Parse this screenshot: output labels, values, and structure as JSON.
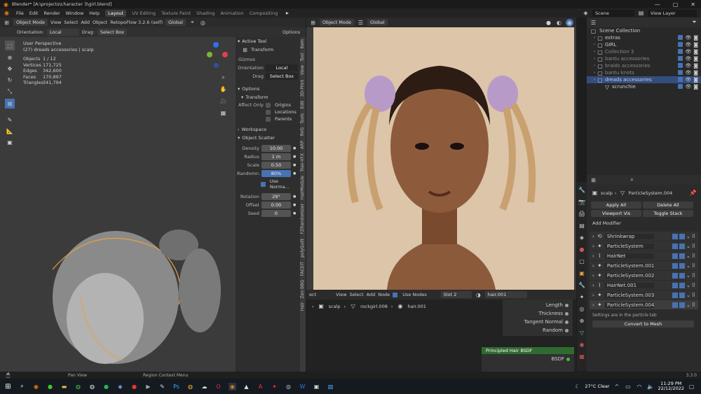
{
  "window": {
    "title": "Blender* [A:\\projects\\character 3\\girl.blend]"
  },
  "menu": [
    "File",
    "Edit",
    "Render",
    "Window",
    "Help"
  ],
  "workspaces": [
    "Layout",
    "UV Editing",
    "Texture Paint",
    "Shading",
    "Animation",
    "Compositing"
  ],
  "scene": {
    "label": "Scene",
    "view_layer": "View Layer"
  },
  "viewport": {
    "mode": "Object Mode",
    "menus": [
      "View",
      "Select",
      "Add",
      "Object"
    ],
    "addon": "RetopoFlow 3.2.6 (self)",
    "transform": "Global",
    "orientation_label": "Orientation:",
    "orientation_value": "Local",
    "drag_label": "Drag:",
    "drag_value": "Select Box",
    "options": "Options",
    "info_title": "User Perspective",
    "info_sub": "(27) dreads accessories | scalp",
    "stats": [
      {
        "k": "Objects",
        "v": "1 / 12"
      },
      {
        "k": "Vertices",
        "v": "171,725"
      },
      {
        "k": "Edges",
        "v": "342,600"
      },
      {
        "k": "Faces",
        "v": "170,897"
      },
      {
        "k": "Triangles",
        "v": "341,794"
      }
    ]
  },
  "npanel": {
    "active_tool": "Active Tool",
    "transform": "Transform",
    "gizmos": "Gizmos",
    "orientation_label": "Orientation",
    "orientation_value": "Local",
    "drag_label": "Drag",
    "drag_value": "Select Box",
    "options": "Options",
    "transform_sub": "Transform",
    "affect_only": "Affect Only",
    "origins": "Origins",
    "locations": "Locations",
    "parents": "Parents",
    "workspace": "Workspace",
    "scatter": "Object Scatter",
    "fields": [
      {
        "k": "Density",
        "v": "10.00"
      },
      {
        "k": "Radius",
        "v": "1 m"
      },
      {
        "k": "Scale",
        "v": "0.50"
      },
      {
        "k": "Randomn.",
        "v": "80%"
      }
    ],
    "use_normal": "Use Norma...",
    "fields2": [
      {
        "k": "Rotation",
        "v": "29°"
      },
      {
        "k": "Offset",
        "v": "0.00"
      },
      {
        "k": "Seed",
        "v": "0"
      }
    ],
    "tabs": [
      "Item",
      "Tool",
      "View",
      "3D-Print",
      "Edit",
      "Tools",
      "RVG",
      "ARP",
      "Tran-VFX",
      "HairModule",
      "FZRandomizer",
      "polyQuilt",
      "FACEIT",
      "Zen BBQ",
      "Hair"
    ]
  },
  "render_view": {
    "mode": "Object Mode",
    "transform": "Global"
  },
  "node_editor": {
    "menus": [
      "ect",
      "View",
      "Select",
      "Add",
      "Node"
    ],
    "use_nodes": "Use Nodes",
    "slot": "Slot 2",
    "material": "hair.001",
    "breadcrumb": [
      "scalp",
      "rockgirl.008",
      "hair.001"
    ],
    "sockets": [
      "Length",
      "Thickness",
      "Tangent Normal",
      "Random"
    ],
    "node_title": "Principled Hair BSDF",
    "node_out": "BSDF"
  },
  "outliner": {
    "root": "Scene Collection",
    "items": [
      "extras",
      "GIRL",
      "Collection 3",
      "bantu accessories",
      "braids accessories",
      "bantu knots",
      "dreads accessories",
      "scrunchie"
    ]
  },
  "properties": {
    "breadcrumb_obj": "scalp",
    "breadcrumb_sys": "ParticleSystem.004",
    "apply_all": "Apply All",
    "delete_all": "Delete All",
    "viewport_vis": "Viewport Vis",
    "toggle_stack": "Toggle Stack",
    "add_modifier": "Add Modifier",
    "modifiers": [
      "Shrinkwrap",
      "ParticleSystem",
      "HairNet",
      "ParticleSystem.001",
      "ParticleSystem.002",
      "HairNet.001",
      "ParticleSystem.003",
      "ParticleSystem.004"
    ],
    "note": "Settings are in the particle tab",
    "convert": "Convert to Mesh"
  },
  "status": {
    "pan": "Pan View",
    "context": "Region Context Menu",
    "version": "3.3.0"
  },
  "taskbar": {
    "weather": "27°C Clear",
    "time": "11:29 PM",
    "date": "22/12/2022"
  }
}
